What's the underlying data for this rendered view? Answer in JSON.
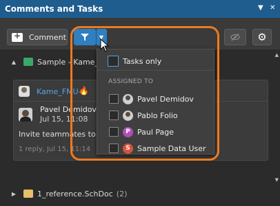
{
  "window": {
    "title": "Comments and Tasks"
  },
  "toolbar": {
    "comment_label": "Comment"
  },
  "documents": [
    {
      "name": "Sample - Kame_",
      "expanded": true
    },
    {
      "name": "1_reference.SchDoc",
      "count": "(2)",
      "expanded": false
    }
  ],
  "comment": {
    "chip_label": "Kame_FMU-1",
    "author": "Pavel Demidov",
    "date": "Jul 15, 11:08",
    "body": "Invite teammates to sta",
    "replies": "1 reply, Jul 15, 11:14"
  },
  "filter_dropdown": {
    "tasks_only_label": "Tasks only",
    "section_label": "ASSIGNED TO",
    "users": [
      {
        "name": "Pavel Demidov",
        "avatar": "photo"
      },
      {
        "name": "Pablo Folio",
        "avatar": "photo"
      },
      {
        "name": "Paul Page",
        "initial": "P",
        "color": "#b04fb8"
      },
      {
        "name": "Sample Data User",
        "initial": "S",
        "color": "#d9533a"
      }
    ]
  },
  "colors": {
    "accent": "#2f7fc1",
    "highlight": "#f07a1e",
    "title_bar": "#1f5d8f"
  }
}
